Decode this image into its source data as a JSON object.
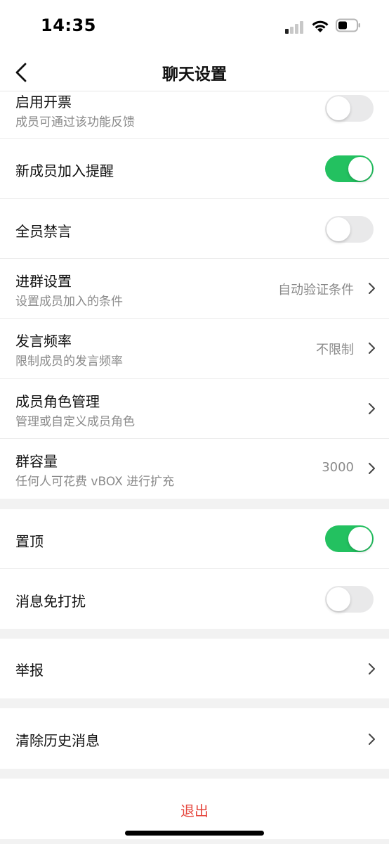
{
  "status_bar": {
    "time": "14:35"
  },
  "nav": {
    "title": "聊天设置"
  },
  "group_settings": [
    {
      "title": "启用开票",
      "subtitle": "成员可通过该功能反馈",
      "toggle_on": false
    },
    {
      "title": "新成员加入提醒",
      "toggle_on": true
    },
    {
      "title": "全员禁言",
      "toggle_on": false
    },
    {
      "title": "进群设置",
      "subtitle": "设置成员加入的条件",
      "value": "自动验证条件"
    },
    {
      "title": "发言频率",
      "subtitle": "限制成员的发言频率",
      "value": "不限制"
    },
    {
      "title": "成员角色管理",
      "subtitle": "管理或自定义成员角色"
    },
    {
      "title": "群容量",
      "subtitle": "任何人可花费 vBOX 进行扩充",
      "value": "3000"
    }
  ],
  "chat_options": [
    {
      "title": "置顶",
      "toggle_on": true
    },
    {
      "title": "消息免打扰",
      "toggle_on": false
    }
  ],
  "report": {
    "title": "举报"
  },
  "clear_history": {
    "title": "清除历史消息"
  },
  "logout": {
    "label": "退出"
  },
  "colors": {
    "accent_green": "#23c160",
    "danger_red": "#e5453c",
    "secondary_text": "#8a8a8a"
  }
}
